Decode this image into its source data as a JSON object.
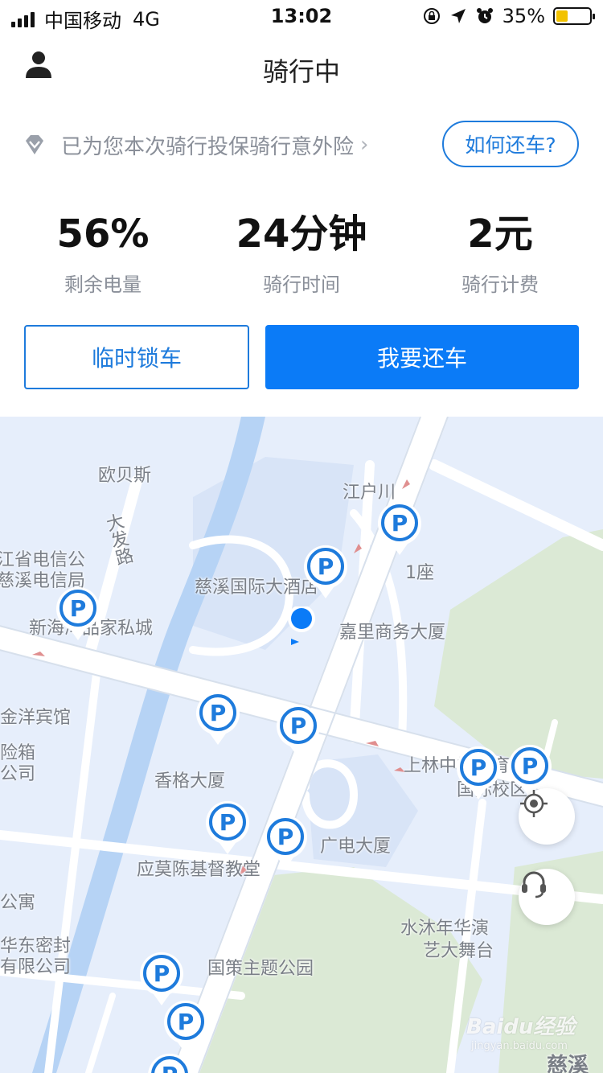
{
  "status_bar": {
    "carrier": "中国移动",
    "network": "4G",
    "time": "13:02",
    "battery_text": "35%",
    "battery_level": 0.35,
    "battery_color": "#f2c200"
  },
  "header": {
    "title": "骑行中",
    "user_icon": "user-icon"
  },
  "insurance": {
    "text": "已为您本次骑行投保骑行意外险",
    "icon": "diamond-icon",
    "chevron": "›"
  },
  "how_to_return_button": "如何还车?",
  "stats": [
    {
      "value": "56%",
      "label": "剩余电量"
    },
    {
      "value": "24分钟",
      "label": "骑行时间"
    },
    {
      "value": "2元",
      "label": "骑行计费"
    }
  ],
  "actions": {
    "temp_lock": "临时锁车",
    "return_bike": "我要还车"
  },
  "colors": {
    "accent": "#0b7bf7",
    "accent_outline": "#1e7bdc",
    "map_water": "#b6d3f5",
    "map_green": "#dbe9d5",
    "map_road": "#ffffff"
  },
  "map": {
    "labels": [
      "欧贝斯",
      "大发路",
      "江户川",
      "1座",
      "江省电信公",
      "慈溪电信局",
      "慈溪国际大酒店",
      "新海湾品家私城",
      "嘉里商务大厦",
      "金洋宾馆",
      "险箱",
      "公司",
      "香格大厦",
      "上林中学教育",
      "国际校区",
      "广电大厦",
      "应莫陈基督教堂",
      "公寓",
      "水沐年华演",
      "艺大舞台",
      "华东密封",
      "有限公司",
      "国策主题公园",
      "慈溪"
    ],
    "locate_icon": "locate-crosshair-icon",
    "service_icon": "headset-icon"
  },
  "watermark": {
    "text": "Baidu经验",
    "sub": "jingyan.baidu.com"
  }
}
